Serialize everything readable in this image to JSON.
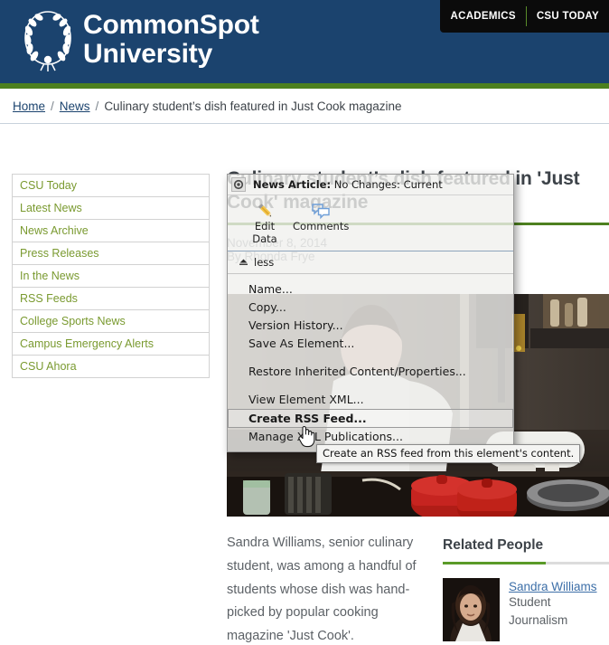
{
  "header": {
    "brand_line1": "CommonSpot",
    "brand_line2": "University",
    "logo_icon": "laurel-wreath-icon",
    "nav_tabs": [
      {
        "label": "ACADEMICS"
      },
      {
        "label": "CSU TODAY"
      }
    ],
    "colors": {
      "navy": "#1b436e",
      "green": "#4d801f",
      "black": "#0b0b0b"
    }
  },
  "breadcrumb": {
    "home": "Home",
    "news": "News",
    "separator": "/",
    "current": "Culinary student’s dish featured in Just Cook magazine"
  },
  "sidenav": {
    "items": [
      {
        "label": "CSU Today"
      },
      {
        "label": "Latest News"
      },
      {
        "label": "News Archive"
      },
      {
        "label": "Press Releases"
      },
      {
        "label": "In the News"
      },
      {
        "label": "RSS Feeds"
      },
      {
        "label": "College Sports News"
      },
      {
        "label": "Campus Emergency Alerts"
      },
      {
        "label": "CSU Ahora"
      }
    ],
    "link_color": "#7a9a30"
  },
  "article": {
    "title": "Culinary student’s dish featured in 'Just Cook' magazine",
    "date": "November 8, 2014",
    "byline": "By Rhonda Frye",
    "body": "Sandra Williams, senior culinary student, was among a handful of students whose dish was hand-picked by popular cooking magazine 'Just Cook'.",
    "photo_alt": "culinary-kitchen-photo"
  },
  "related_people": {
    "title": "Related People",
    "people": [
      {
        "name": "Sandra Williams",
        "role": "Student",
        "department": "Journalism",
        "avatar": "person-avatar"
      }
    ]
  },
  "context_menu": {
    "gear_icon": "gear-icon",
    "element_type": "News Article:",
    "status": " No Changes: Current",
    "actions": [
      {
        "label_line1": "Edit",
        "label_line2": "Data",
        "icon": "pencil-icon"
      },
      {
        "label_line1": "Comments",
        "label_line2": "",
        "icon": "comments-icon"
      }
    ],
    "collapse_label": "less",
    "collapse_icon": "collapse-arrow-icon",
    "items": [
      {
        "label": "Name...",
        "selected": false,
        "gap_before": false
      },
      {
        "label": "Copy...",
        "selected": false,
        "gap_before": false
      },
      {
        "label": "Version History...",
        "selected": false,
        "gap_before": false
      },
      {
        "label": "Save As Element...",
        "selected": false,
        "gap_before": false
      },
      {
        "label": "Restore Inherited Content/Properties...",
        "selected": false,
        "gap_before": true
      },
      {
        "label": "View Element XML...",
        "selected": false,
        "gap_before": true
      },
      {
        "label": "Create RSS Feed...",
        "selected": true,
        "gap_before": false
      },
      {
        "label": "Manage XML Publications...",
        "selected": false,
        "gap_before": false
      }
    ]
  },
  "tooltip": {
    "text": "Create an RSS feed from this element's content."
  },
  "cursor": {
    "type": "pointing-hand-cursor"
  }
}
